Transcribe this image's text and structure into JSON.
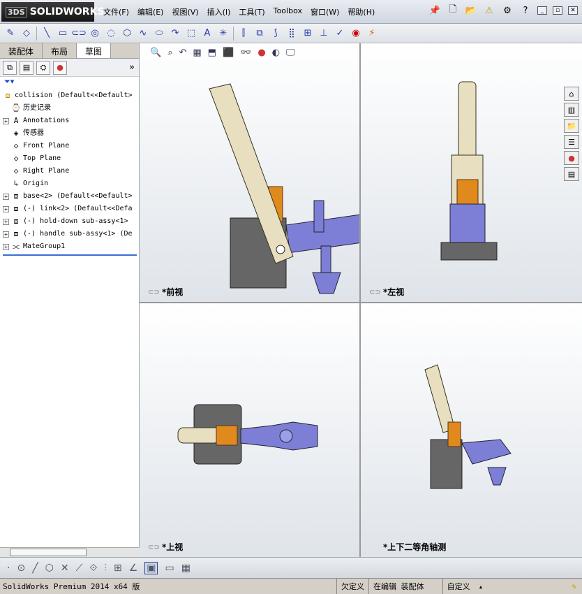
{
  "app": {
    "logo_text": "SOLIDWORKS",
    "logo_prefix": "3DS"
  },
  "menus": [
    "文件(F)",
    "编辑(E)",
    "视图(V)",
    "插入(I)",
    "工具(T)",
    "Toolbox",
    "窗口(W)",
    "帮助(H)"
  ],
  "tabs": [
    "装配体",
    "布局",
    "草图"
  ],
  "tree": {
    "root": "collision  (Default<<Default>",
    "items": [
      {
        "label": "历史记录",
        "icon": "history-icon",
        "expand": false
      },
      {
        "label": "Annotations",
        "icon": "annotation-icon",
        "expand": true
      },
      {
        "label": "传感器",
        "icon": "sensor-icon",
        "expand": false
      },
      {
        "label": "Front Plane",
        "icon": "plane-icon",
        "expand": false
      },
      {
        "label": "Top Plane",
        "icon": "plane-icon",
        "expand": false
      },
      {
        "label": "Right Plane",
        "icon": "plane-icon",
        "expand": false
      },
      {
        "label": "Origin",
        "icon": "origin-icon",
        "expand": false
      },
      {
        "label": "base<2> (Default<<Default>",
        "icon": "part-icon",
        "expand": true
      },
      {
        "label": "(-) link<2> (Default<<Defa",
        "icon": "part-icon",
        "expand": true
      },
      {
        "label": "(-) hold-down sub-assy<1>",
        "icon": "assembly-icon",
        "expand": true
      },
      {
        "label": "(-) handle sub-assy<1> (De",
        "icon": "assembly-icon",
        "expand": true
      },
      {
        "label": "MateGroup1",
        "icon": "mate-icon",
        "expand": true
      }
    ]
  },
  "views": {
    "front": "*前视",
    "left": "*左视",
    "top": "*上视",
    "iso": "*上下二等角轴测"
  },
  "status": {
    "product": "SolidWorks Premium 2014 x64 版",
    "defined": "欠定义",
    "editing": "在编辑 装配体",
    "units": "自定义"
  },
  "colors": {
    "part_light": "#e8dfc0",
    "part_orange": "#e08a1e",
    "part_blue": "#7d7fd6",
    "part_dark": "#6a6a6a"
  }
}
